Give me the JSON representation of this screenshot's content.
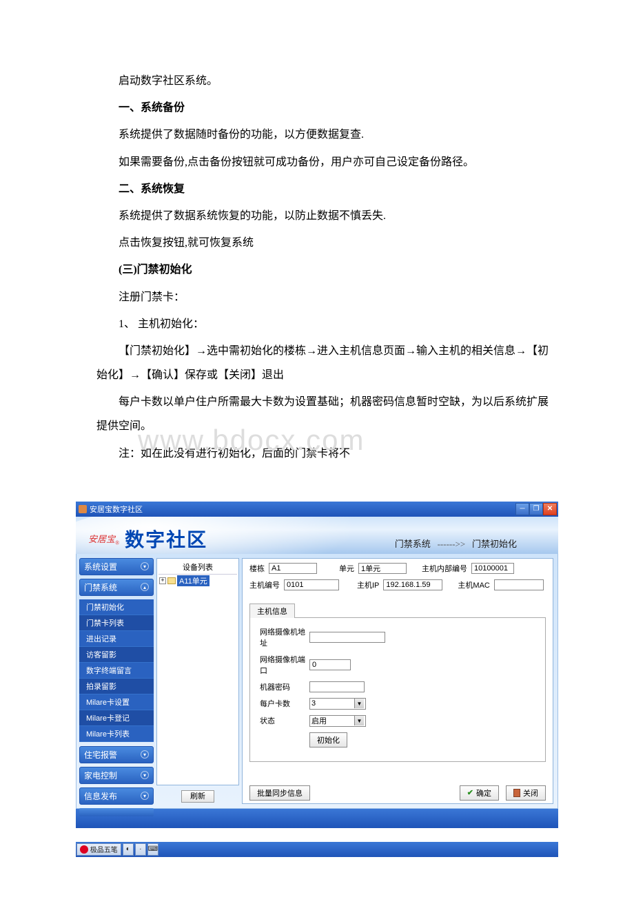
{
  "doc": {
    "p1": "启动数字社区系统。",
    "h1": "一、系统备份",
    "p2": "系统提供了数据随时备份的功能，以方便数据复查.",
    "p3": "如果需要备份,点击备份按钮就可成功备份，用户亦可自己设定备份路径。",
    "h2": "二、系统恢复",
    "p4": "系统提供了数据系统恢复的功能，以防止数据不慎丢失.",
    "p5": "点击恢复按钮,就可恢复系统",
    "h3": "(三)门禁初始化",
    "p6": "注册门禁卡：",
    "p7": "1、 主机初始化：",
    "p8": "【门禁初始化】→选中需初始化的楼栋→进入主机信息页面→输入主机的相关信息→【初始化】→【确认】保存或【关闭】退出",
    "p9": "每户卡数以单户住户所需最大卡数为设置基础；机器密码信息暂时空缺，为以后系统扩展提供空间。",
    "p10": "注：如在此没有进行初始化，后面的门禁卡将不"
  },
  "watermark": "www.bdocx.com",
  "app": {
    "title": "安居宝数字社区",
    "brand": "数字社区",
    "breadcrumb": {
      "a": "门禁系统",
      "sep": "------>>",
      "b": "门禁初始化"
    },
    "sidebar": {
      "sections": [
        {
          "label": "系统设置",
          "open": false
        },
        {
          "label": "门禁系统",
          "open": true
        },
        {
          "label": "住宅报警",
          "open": false
        },
        {
          "label": "家电控制",
          "open": false
        },
        {
          "label": "信息发布",
          "open": false
        }
      ],
      "items": [
        "门禁初始化",
        "门禁卡列表",
        "进出记录",
        "访客留影",
        "数字终端留言",
        "拍录留影",
        "Milare卡设置",
        "Milare卡登记",
        "Milare卡列表"
      ]
    },
    "tree": {
      "header": "设备列表",
      "node": "A11单元"
    },
    "refresh_label": "刷新",
    "form": {
      "bld_label": "楼栋",
      "bld_val": "A1",
      "unit_label": "单元",
      "unit_val": "1单元",
      "innerno_label": "主机内部编号",
      "innerno_val": "10100001",
      "hostno_label": "主机编号",
      "hostno_val": "0101",
      "ip_label": "主机IP",
      "ip_val": "192.168.1.59",
      "mac_label": "主机MAC",
      "mac_val": "",
      "tab": "主机信息",
      "camaddr_label": "网络摄像机地址",
      "camaddr_val": "",
      "camport_label": "网络摄像机端口",
      "camport_val": "0",
      "pwd_label": "机器密码",
      "pwd_val": "",
      "cards_label": "每户卡数",
      "cards_val": "3",
      "state_label": "状态",
      "state_val": "启用",
      "init_btn": "初始化"
    },
    "footer": {
      "batch": "批量同步信息",
      "ok": "确定",
      "close": "关闭"
    }
  },
  "taskbar": {
    "ime": "极品五笔"
  }
}
